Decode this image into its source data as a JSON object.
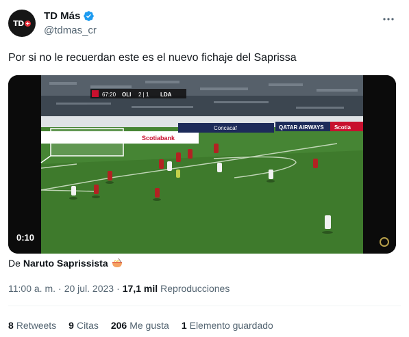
{
  "author": {
    "display_name": "TD Más",
    "handle": "@tdmas_cr",
    "avatar_text": "TD",
    "avatar_plus": "+"
  },
  "tweet": {
    "text": "Por si no le recuerdan este es el nuevo fichaje del Saprissa"
  },
  "media": {
    "duration": "0:10",
    "scoreboard": {
      "time": "67:20",
      "home": "OLI",
      "score": "2 | 1",
      "away": "LDA"
    },
    "banners": {
      "scotiabank": "Scotiabank",
      "qatar": "QATAR AIRWAYS",
      "concacaf": "Concacaf",
      "scotia_right": "Scotia"
    }
  },
  "attribution": {
    "prefix": "De",
    "name": "Naruto Saprissista"
  },
  "meta": {
    "time": "11:00 a. m.",
    "separator1": "·",
    "date": "20 jul. 2023",
    "separator2": "·",
    "views_count": "17,1 mil",
    "views_label": "Reproducciones"
  },
  "stats": {
    "retweets_count": "8",
    "retweets_label": "Retweets",
    "quotes_count": "9",
    "quotes_label": "Citas",
    "likes_count": "206",
    "likes_label": "Me gusta",
    "bookmarks_count": "1",
    "bookmarks_label": "Elemento guardado"
  },
  "colors": {
    "verified": "#1d9bf0",
    "muted": "#536471",
    "text": "#0f1419"
  }
}
